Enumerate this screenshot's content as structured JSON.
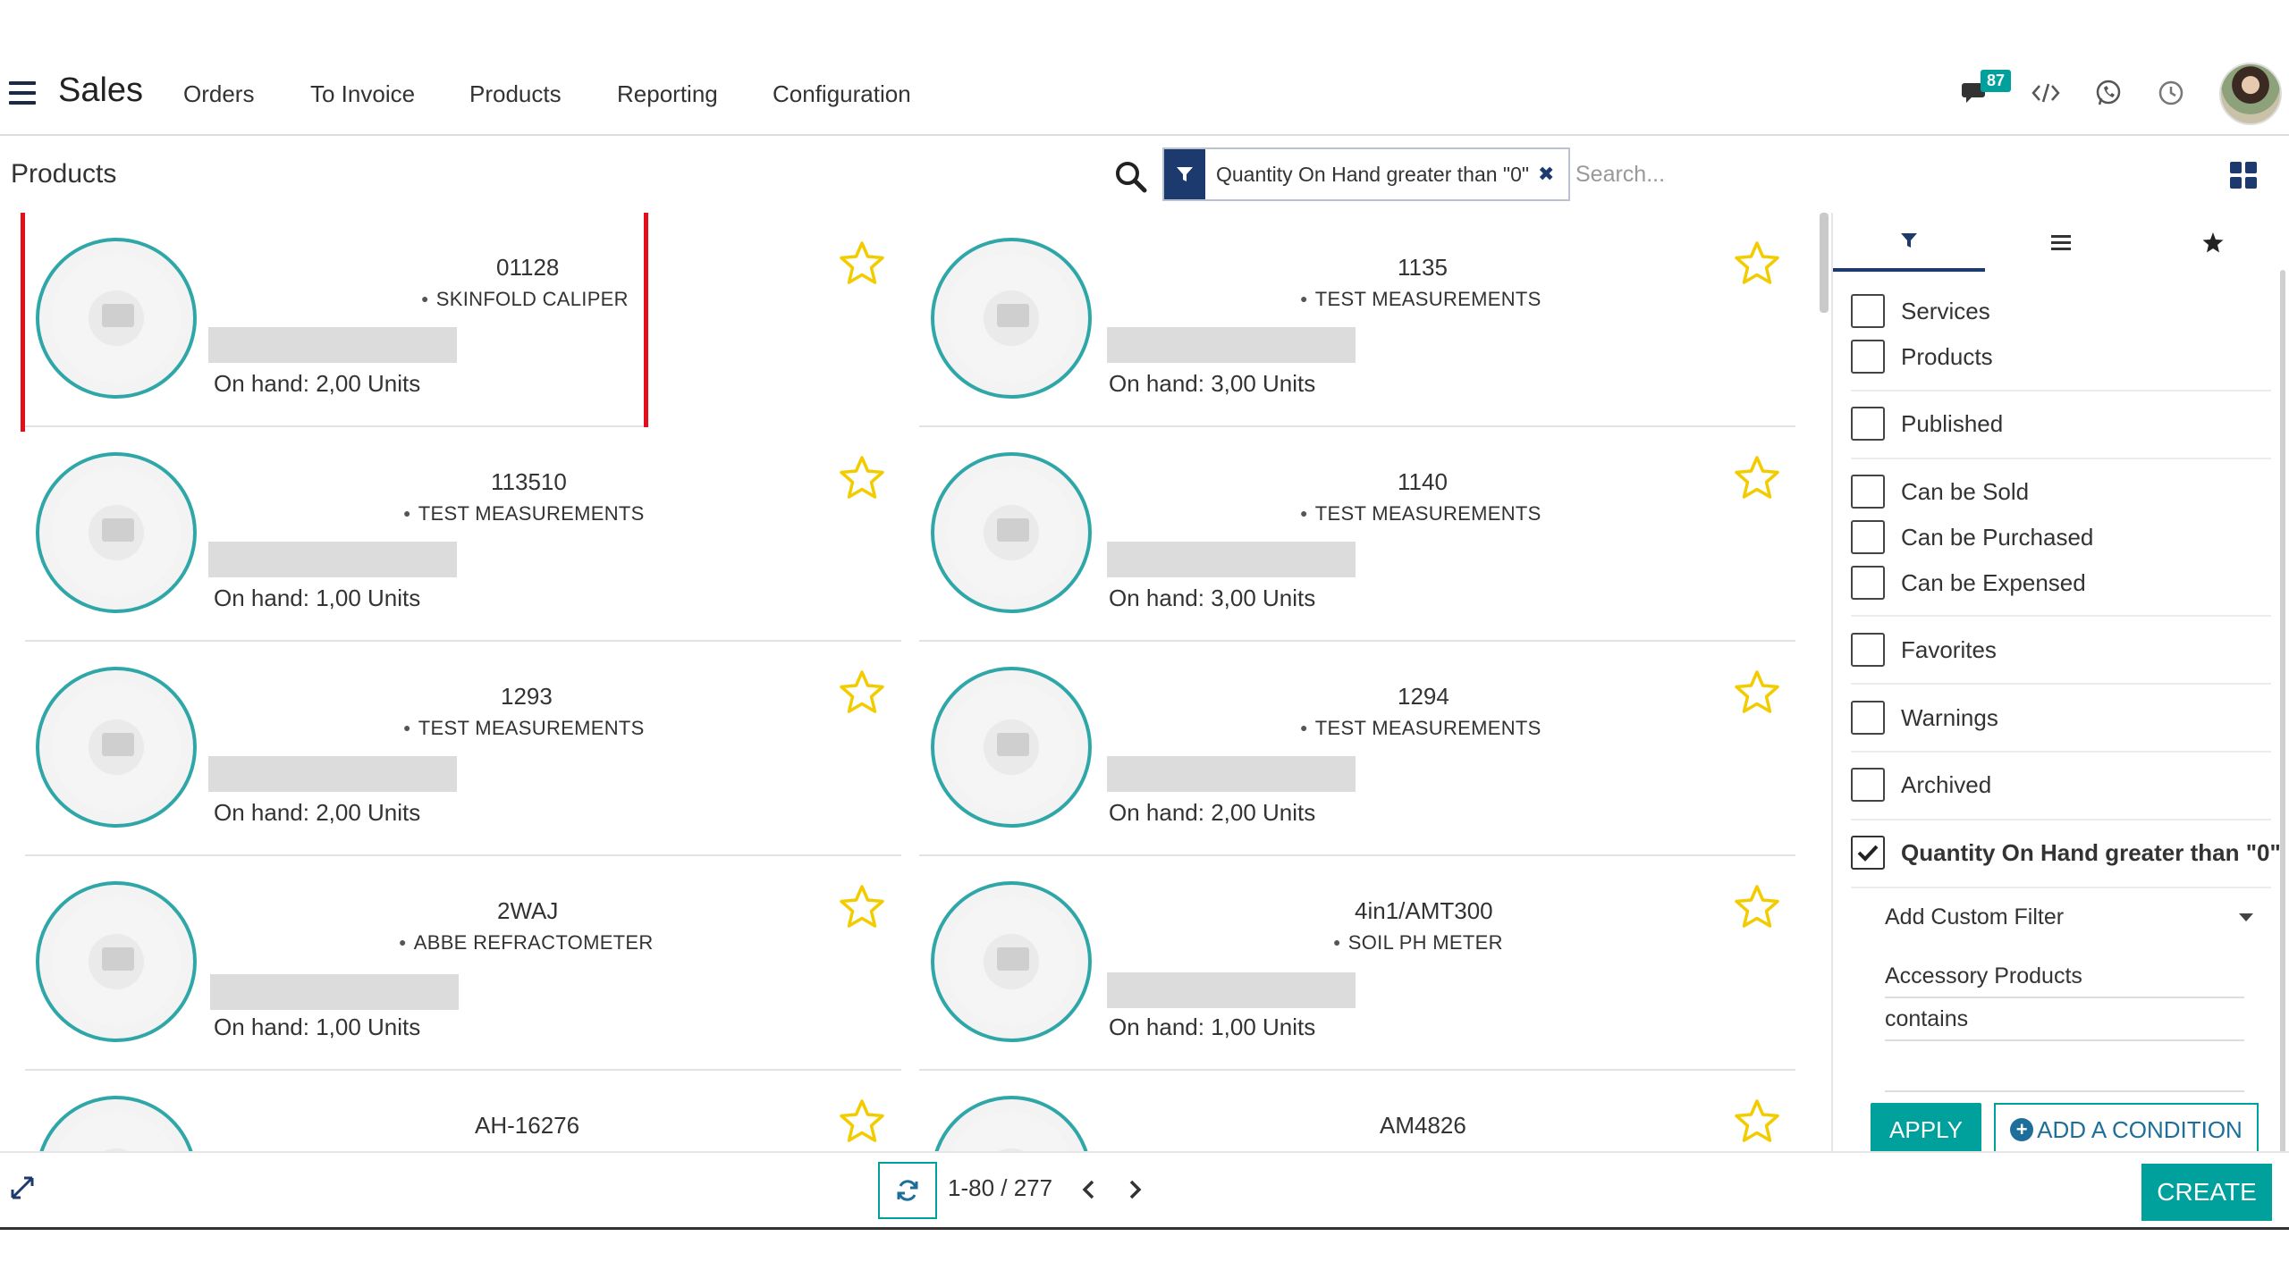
{
  "app": {
    "name": "Sales",
    "menu": [
      "Orders",
      "To Invoice",
      "Products",
      "Reporting",
      "Configuration"
    ],
    "notification_count": "87",
    "brand_color": "#00a09d",
    "primary_dark": "#1d3a6e"
  },
  "control_panel": {
    "title": "Products",
    "facet_label": "Quantity On Hand greater than \"0\"",
    "search_placeholder": "Search..."
  },
  "products": [
    {
      "ref": "01128",
      "category": "SKINFOLD CALIPER",
      "on_hand": "On hand: 2,00 Units"
    },
    {
      "ref": "1135",
      "category": "TEST MEASUREMENTS",
      "on_hand": "On hand: 3,00 Units"
    },
    {
      "ref": "113510",
      "category": "TEST MEASUREMENTS",
      "on_hand": "On hand: 1,00 Units"
    },
    {
      "ref": "1140",
      "category": "TEST MEASUREMENTS",
      "on_hand": "On hand: 3,00 Units"
    },
    {
      "ref": "1293",
      "category": "TEST MEASUREMENTS",
      "on_hand": "On hand: 2,00 Units"
    },
    {
      "ref": "1294",
      "category": "TEST MEASUREMENTS",
      "on_hand": "On hand: 2,00 Units"
    },
    {
      "ref": "2WAJ",
      "category": "ABBE REFRACTOMETER",
      "on_hand": "On hand: 1,00 Units"
    },
    {
      "ref": "4in1/AMT300",
      "category": "SOIL PH METER",
      "on_hand": "On hand: 1,00 Units"
    },
    {
      "ref": "AH-16276",
      "category": "",
      "on_hand": ""
    },
    {
      "ref": "AM4826",
      "category": "",
      "on_hand": ""
    }
  ],
  "filter_panel": {
    "filters": [
      {
        "label": "Services",
        "checked": false
      },
      {
        "label": "Products",
        "checked": false
      },
      {
        "label": "Published",
        "checked": false
      },
      {
        "label": "Can be Sold",
        "checked": false
      },
      {
        "label": "Can be Purchased",
        "checked": false
      },
      {
        "label": "Can be Expensed",
        "checked": false
      },
      {
        "label": "Favorites",
        "checked": false
      },
      {
        "label": "Warnings",
        "checked": false
      },
      {
        "label": "Archived",
        "checked": false
      },
      {
        "label": "Quantity On Hand greater than \"0\"",
        "checked": true
      }
    ],
    "custom_filter_label": "Add Custom Filter",
    "custom_field": "Accessory Products",
    "custom_operator": "contains",
    "custom_value": "",
    "apply_label": "APPLY",
    "add_condition_label": "ADD A CONDITION"
  },
  "pager": {
    "value": "1-80 / 277"
  },
  "create_label": "CREATE",
  "star_color": "#f3cc00",
  "highlight_color": "#e3101c"
}
